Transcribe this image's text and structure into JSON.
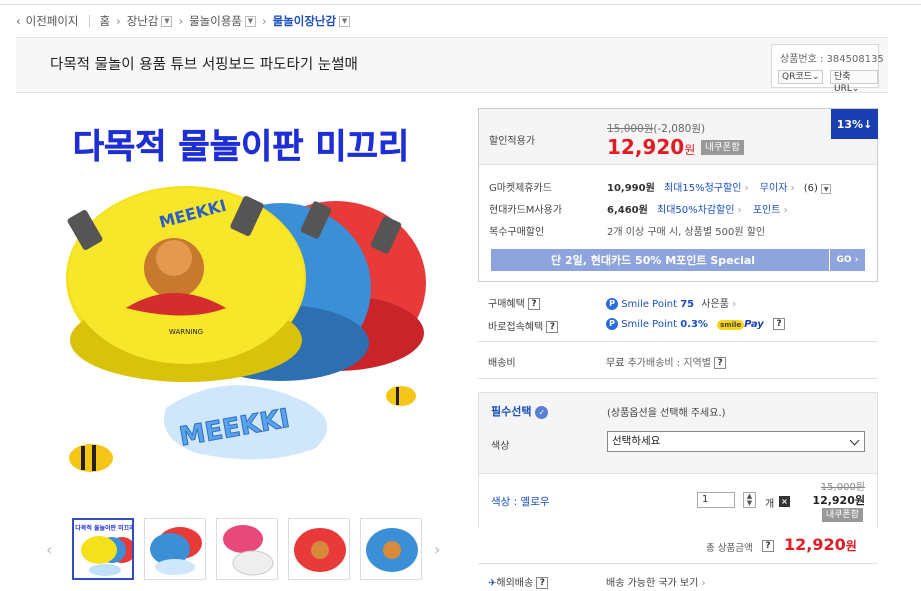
{
  "breadcrumb": {
    "back": "이전페이지",
    "home": "홈",
    "cat1": "장난감",
    "cat2": "물놀이용품",
    "cat3": "물놀이장난감"
  },
  "product": {
    "title": "다목적 물놀이 용품 튜브 서핑보드 파도타기 눈썰매",
    "number_label": "상품번호 : 384508135",
    "qr_label": "QR코드",
    "short_url_label": "단축 URL",
    "image_banner": "다목적 물놀이판 미끄리",
    "image_brand": "MEEKKI"
  },
  "price": {
    "discount_label": "할인적용가",
    "original": "15,000원",
    "discount_amount": "(-2,080원)",
    "sale": "12,920",
    "won": "원",
    "coupon": "내쿠폰함",
    "rate": "13%",
    "gmarket_label": "G마켓제휴카드",
    "gmarket_price": "10,990원",
    "gmarket_detail": "최대15%청구할인",
    "gmarket_extra": "무이자",
    "gmarket_count": "(6)",
    "hyundai_label": "현대카드M사용가",
    "hyundai_price": "6,460원",
    "hyundai_detail": "최대50%차감할인",
    "hyundai_point": "포인트",
    "multi_label": "복수구매할인",
    "multi_detail": "2개 이상 구매 시, 상품별 500원 할인",
    "banner_text": "단 2일, 현대카드 50% M포인트 Special",
    "banner_go": "GO"
  },
  "benefits": {
    "buy_label": "구매혜택",
    "buy_value": "Smile Point",
    "buy_points": "75",
    "buy_extra": "사은품",
    "instant_label": "바로접속혜택",
    "instant_value": "Smile Point",
    "instant_rate": "0.3%",
    "smilepay": "Pay",
    "shipping_label": "배송비",
    "shipping_value": "무료",
    "shipping_extra": "추가배송비 : 지역별"
  },
  "options": {
    "required_label": "필수선택",
    "required_hint": "(상품옵션을 선택해 주세요.)",
    "color_label": "색상",
    "select_placeholder": "선택하세요",
    "selected_name": "색상 : 옐로우",
    "quantity": "1",
    "unit": "개",
    "orig_price": "15,000원",
    "price": "12,920원",
    "coupon": "내쿠폰함"
  },
  "total": {
    "label": "총 상품금액",
    "value": "12,920",
    "won": "원"
  },
  "overseas": {
    "label": "해외배송",
    "value": "배송 가능한 국가 보기"
  }
}
